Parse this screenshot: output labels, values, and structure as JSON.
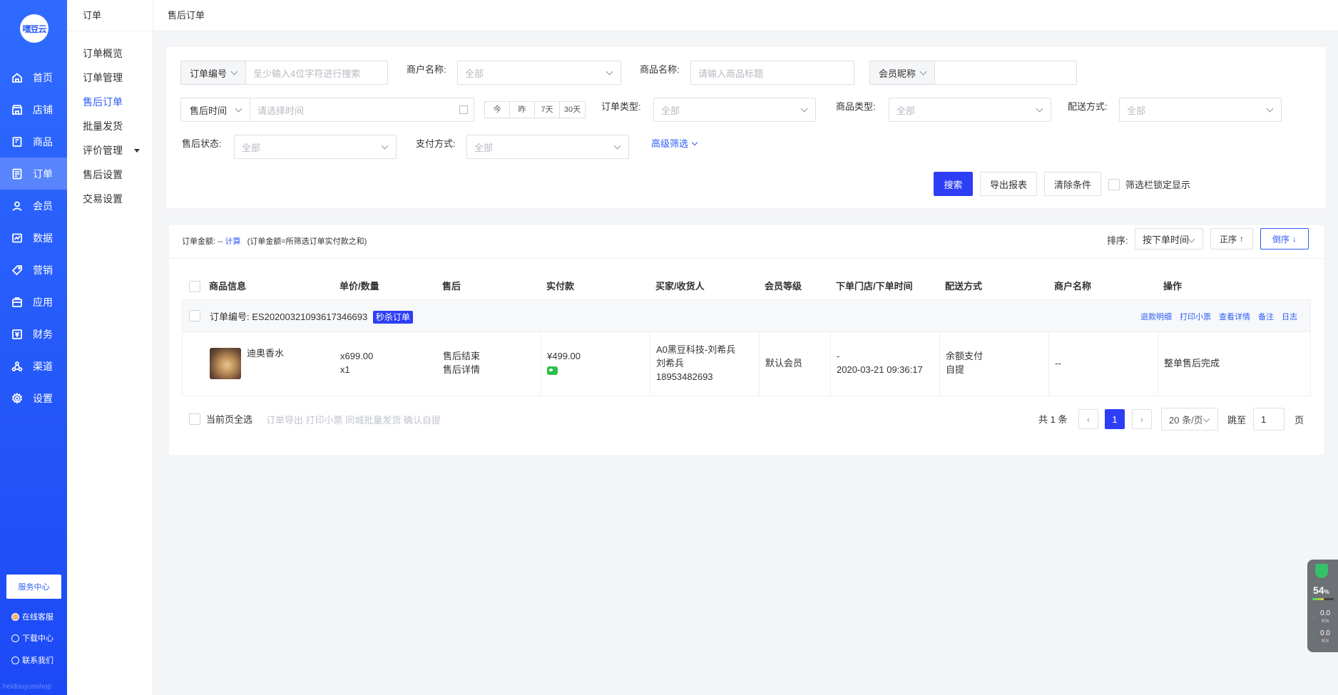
{
  "sidebar": {
    "logo": "嘿豆云",
    "items": [
      {
        "label": "首页",
        "icon": "home-icon"
      },
      {
        "label": "店铺",
        "icon": "store-icon"
      },
      {
        "label": "商品",
        "icon": "goods-icon"
      },
      {
        "label": "订单",
        "icon": "order-icon"
      },
      {
        "label": "会员",
        "icon": "member-icon"
      },
      {
        "label": "数据",
        "icon": "data-icon"
      },
      {
        "label": "营销",
        "icon": "tag-icon"
      },
      {
        "label": "应用",
        "icon": "app-icon"
      },
      {
        "label": "财务",
        "icon": "finance-icon"
      },
      {
        "label": "渠道",
        "icon": "channel-icon"
      },
      {
        "label": "设置",
        "icon": "gear-icon"
      }
    ],
    "service_center": "服务中心",
    "online_service": "在线客服",
    "download_center": "下载中心",
    "contact_us": "联系我们",
    "watermark": "heidouyunshop"
  },
  "subnav": {
    "title": "订单",
    "items": [
      "订单概览",
      "订单管理",
      "售后订单",
      "批量发货",
      "评价管理",
      "售后设置",
      "交易设置"
    ]
  },
  "page_title": "售后订单",
  "filters": {
    "order_no_label": "订单编号",
    "order_no_placeholder": "至少输入4位字符进行搜索",
    "merchant_label": "商户名称:",
    "merchant_value": "全部",
    "goods_name_label": "商品名称:",
    "goods_name_placeholder": "请输入商品标题",
    "member_label": "会员昵称",
    "time_type": "售后时间",
    "time_placeholder": "请选择时间",
    "quick_ranges": [
      "今",
      "昨",
      "7天",
      "30天"
    ],
    "order_type_label": "订单类型:",
    "order_type_value": "全部",
    "goods_type_label": "商品类型:",
    "goods_type_value": "全部",
    "delivery_label": "配送方式:",
    "delivery_value": "全部",
    "status_label": "售后状态:",
    "status_value": "全部",
    "pay_label": "支付方式:",
    "pay_value": "全部",
    "advanced": "高级筛选",
    "search_btn": "搜索",
    "export_btn": "导出报表",
    "clear_btn": "清除条件",
    "lock_label": "筛选栏锁定显示"
  },
  "summary": {
    "label": "订单金额:",
    "value": "--",
    "calc": "计算",
    "note": "(订单金额=所筛选订单实付款之和)"
  },
  "sort": {
    "label": "排序:",
    "value": "按下单时间",
    "asc": "正序",
    "desc": "倒序"
  },
  "table": {
    "columns": [
      "商品信息",
      "单价/数量",
      "售后",
      "实付款",
      "买家/收货人",
      "会员等级",
      "下单门店/下单时间",
      "配送方式",
      "商户名称",
      "操作"
    ],
    "order": {
      "order_no_label": "订单编号:",
      "order_no": "ES20200321093617346693",
      "tag": "秒杀订单",
      "actions": [
        "退款明细",
        "打印小票",
        "查看详情",
        "备注",
        "日志"
      ],
      "goods_name": "迪奥香水",
      "price": "x699.00",
      "qty": "x1",
      "aftersale_status": "售后结束",
      "aftersale_link": "售后详情",
      "paid": "¥499.00",
      "buyer": "A0黑豆科技-刘希兵",
      "receiver": "刘希兵",
      "phone": "18953482693",
      "member_level": "默认会员",
      "store": "-",
      "order_time": "2020-03-21 09:36:17",
      "delivery_pay": "余额支付",
      "delivery_method": "自提",
      "merchant": "--",
      "operation": "整单售后完成"
    }
  },
  "footer": {
    "select_all": "当前页全选",
    "bulk_actions": "订单导出 打印小票 同城批量发货 确认自提",
    "total": "共 1 条",
    "page": "1",
    "page_size": "20 条/页",
    "goto_label": "跳至",
    "goto_value": "1",
    "page_unit": "页"
  },
  "monitor": {
    "percent": "54",
    "percent_unit": "%",
    "percent_value": 54,
    "up": "0.0",
    "down": "0.0",
    "unit": "K/s"
  }
}
